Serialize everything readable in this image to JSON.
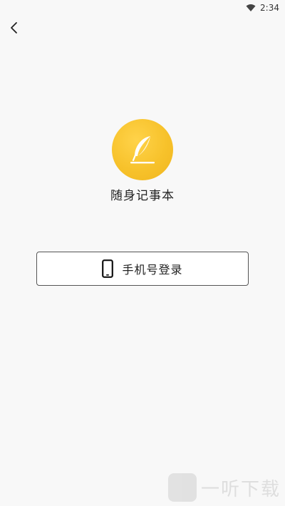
{
  "status_bar": {
    "time": "2:34",
    "icons": [
      "wifi-icon"
    ]
  },
  "nav": {
    "back_icon": "chevron-left-icon"
  },
  "app": {
    "logo_icon": "feather-quill-icon",
    "name": "随身记事本"
  },
  "login": {
    "icon": "smartphone-icon",
    "label": "手机号登录"
  },
  "watermark": {
    "text": "一听下载"
  },
  "colors": {
    "background": "#f8f8f8",
    "logo": "#f7c22b",
    "button_border": "#555555"
  }
}
